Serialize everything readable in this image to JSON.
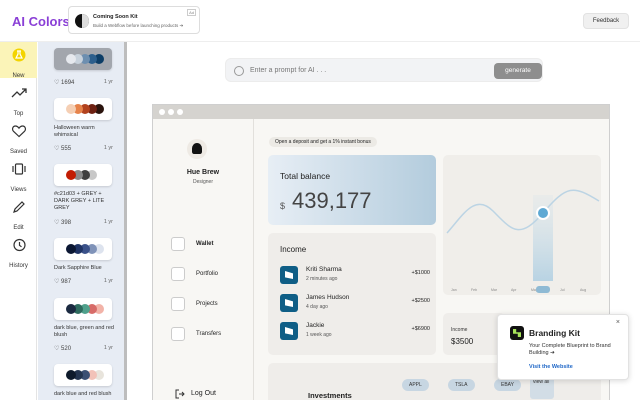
{
  "app": {
    "title": "AI Colors",
    "feedback_label": "Feedback",
    "accent": "#8a3fd6"
  },
  "promo": {
    "title": "Coming Soon Kit",
    "subtitle": "Build a Webflow before launching products ➔",
    "ad_label": "Ad"
  },
  "leftnav": [
    {
      "label": "New",
      "icon": "new-flask-icon",
      "active": true
    },
    {
      "label": "Top",
      "icon": "trending-icon"
    },
    {
      "label": "Saved",
      "icon": "heart-icon"
    },
    {
      "label": "Views",
      "icon": "views-icon"
    },
    {
      "label": "Edit",
      "icon": "pencil-icon"
    },
    {
      "label": "History",
      "icon": "history-icon"
    }
  ],
  "palettes": [
    {
      "name": "",
      "likes": "1694",
      "age": "1 yr",
      "colors": [
        "#e6e9ee",
        "#c8d2dc",
        "#6d8fb0",
        "#2b5e8c",
        "#0c3d66"
      ],
      "card": "gray"
    },
    {
      "name": "Halloween warm whimsical",
      "likes": "555",
      "age": "1 yr",
      "colors": [
        "#f5cfb4",
        "#e6834a",
        "#b2421e",
        "#6d2012",
        "#2a130d"
      ]
    },
    {
      "name": "#c21d03 + GREY + DARK GREY + LITE GREY",
      "likes": "398",
      "age": "1 yr",
      "colors": [
        "#c21d03",
        "#8a8a8a",
        "#3f3f3f",
        "#c8c8c8"
      ]
    },
    {
      "name": "Dark Sapphire Blue",
      "likes": "987",
      "age": "1 yr",
      "colors": [
        "#0b1733",
        "#1f3364",
        "#3a5189",
        "#7f92b8",
        "#dde3ee"
      ]
    },
    {
      "name": "dark blue, green and red blush",
      "likes": "520",
      "age": "1 yr",
      "colors": [
        "#1b2a41",
        "#2e6b5e",
        "#4fa08b",
        "#d76b68",
        "#f2b3a8"
      ]
    },
    {
      "name": "dark blue and red blush",
      "likes": "",
      "age": "1 yr",
      "colors": [
        "#0e1a2b",
        "#23344f",
        "#3b4f73",
        "#f2c2b8",
        "#e8e4dc"
      ]
    }
  ],
  "prompt": {
    "placeholder": "Enter a prompt for AI . . .",
    "button_label": "generate"
  },
  "preview": {
    "user_name": "Hue Brew",
    "user_role": "Designer",
    "nav": [
      "Wallet",
      "Portfolio",
      "Projects",
      "Transfers"
    ],
    "logout": "Log Out",
    "bonus_pill": "Open a deposit and get a 1% instant bonus",
    "balance_title": "Total balance",
    "balance_currency": "$",
    "balance_amount": "439,177",
    "income_title": "Income",
    "income_rows": [
      {
        "name": "Kriti Sharma",
        "time": "2 minutes ago",
        "amount": "+$1000"
      },
      {
        "name": "James Hudson",
        "time": "4 day ago",
        "amount": "+$2500"
      },
      {
        "name": "Jackie",
        "time": "1 week ago",
        "amount": "+$6900"
      }
    ],
    "income_small_label": "Income",
    "income_small_value": "$3500",
    "investments_title": "Investments",
    "tags": [
      "APPL",
      "TSLA",
      "EBAY"
    ],
    "view_all": "view all"
  },
  "branding": {
    "title": "Branding Kit",
    "description": "Your Complete Blueprint to Brand Building ➔",
    "link": "Visit the Website",
    "close": "×"
  }
}
